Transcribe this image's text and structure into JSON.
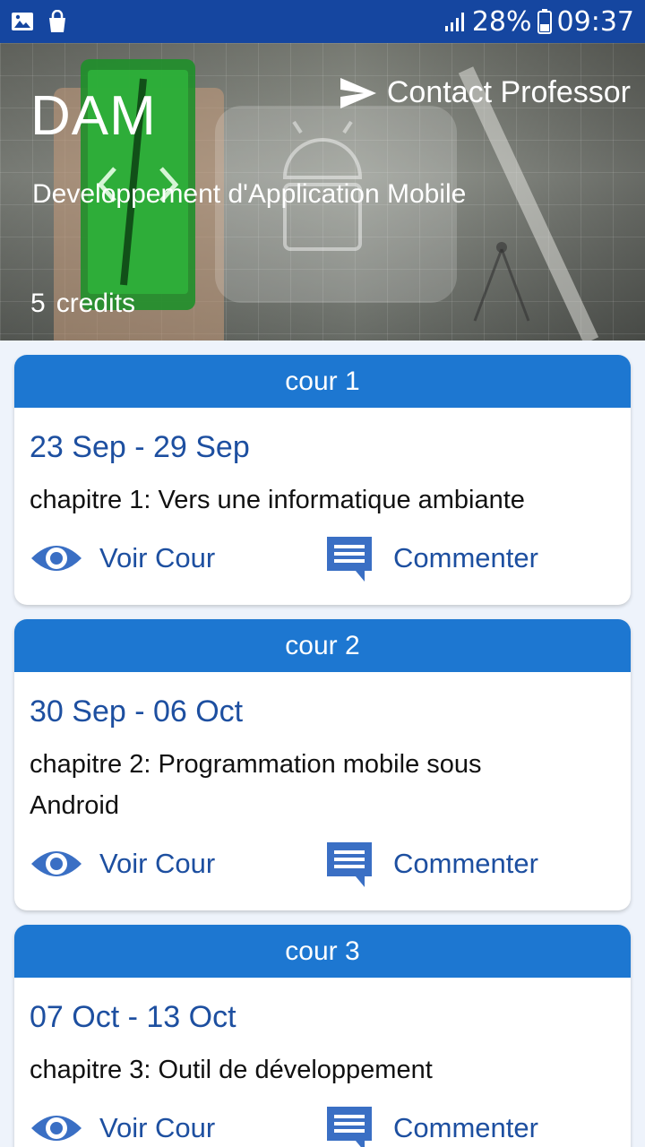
{
  "status_bar": {
    "left_icons": [
      "image-icon",
      "shopping-bag-icon"
    ],
    "battery": "28%",
    "time": "09:37"
  },
  "hero": {
    "title": "DAM",
    "subtitle": "Developpement d'Application Mobile",
    "credits_value": "5",
    "credits_label": "credits",
    "contact_label": "Contact Professor"
  },
  "courses": [
    {
      "header": "cour 1",
      "dates": "23 Sep - 29 Sep",
      "chapter": "chapitre 1: Vers une informatique ambiante",
      "view_label": "Voir Cour",
      "comment_label": "Commenter"
    },
    {
      "header": "cour 2",
      "dates": "30 Sep - 06 Oct",
      "chapter": "chapitre 2: Programmation mobile sous Android",
      "view_label": "Voir Cour",
      "comment_label": "Commenter"
    },
    {
      "header": "cour 3",
      "dates": "07 Oct - 13 Oct",
      "chapter": "chapitre 3: Outil de développement",
      "view_label": "Voir Cour",
      "comment_label": "Commenter"
    }
  ],
  "colors": {
    "status_bar": "#1546a0",
    "card_header": "#1d77d1",
    "accent_text": "#1d4fa0",
    "page_bg": "#eef3fb"
  }
}
